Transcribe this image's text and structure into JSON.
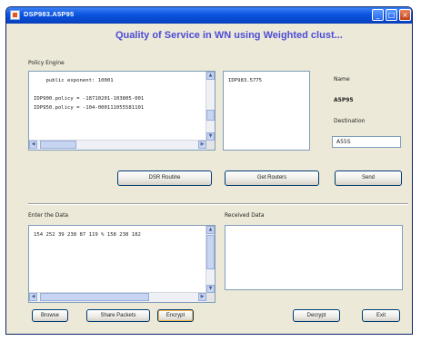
{
  "window": {
    "title": "DSP983.A5P95",
    "controls": {
      "minimize": "_",
      "maximize": "□",
      "close": "×"
    }
  },
  "heading": "Quality of Service in WN using Weighted clust...",
  "policy": {
    "label": "Policy Engine",
    "text": "    public exponent: 10001\n\nIDP900.policy = -18710201-103805-001\nIDP950.policy = -104-000111055581101"
  },
  "routers": {
    "text": "IDP983.5775"
  },
  "name": {
    "label": "Name",
    "value": "A5P95"
  },
  "destination": {
    "label": "Destination",
    "value": "A55S"
  },
  "buttons": {
    "dsr_routine": "DSR Routine",
    "get_routers": "Get Routers",
    "send": "Send",
    "browse": "Browse",
    "share_packets": "Share Packets",
    "encrypt": "Encrypt",
    "decrypt": "Decrypt",
    "exit": "Exit"
  },
  "enter_data": {
    "label": "Enter the Data",
    "text": "154 252 39 238 87 119 % 158 238 182"
  },
  "received_data": {
    "label": "Received Data",
    "text": ""
  },
  "icons": {
    "scroll_up": "▲",
    "scroll_down": "▼",
    "scroll_left": "◀",
    "scroll_right": "▶"
  },
  "colors": {
    "titlebar": "#0a54e0",
    "heading": "#4c4cd6",
    "window_bg": "#ece9d8"
  }
}
